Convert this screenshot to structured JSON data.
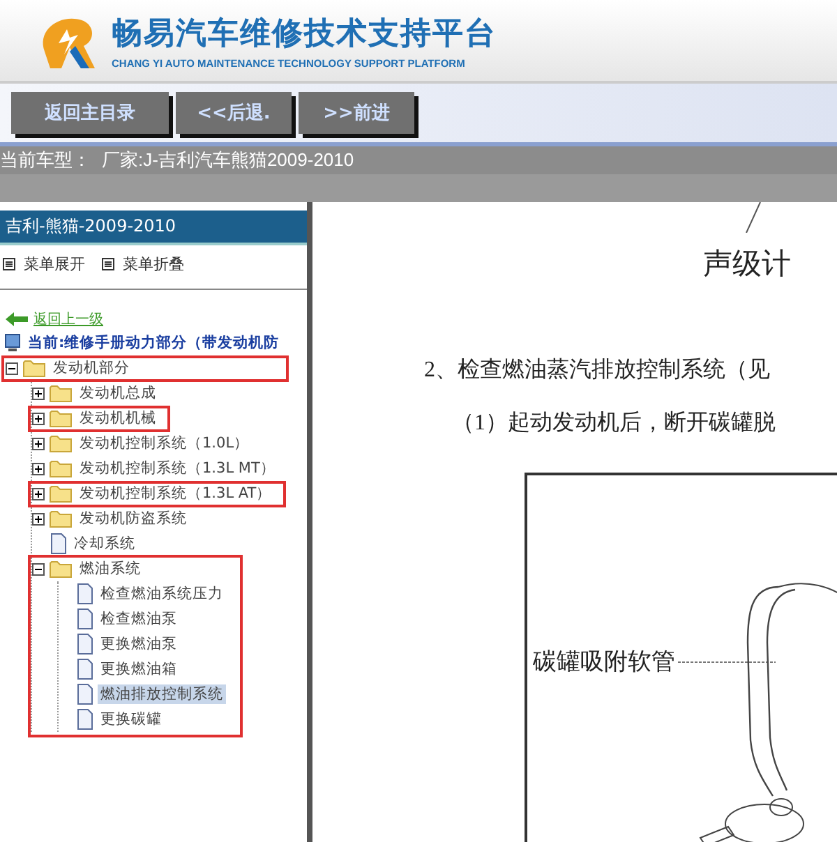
{
  "header": {
    "title": "畅易汽车维修技术支持平台",
    "subtitle": "CHANG YI AUTO MAINTENANCE TECHNOLOGY SUPPORT PLATFORM"
  },
  "toolbar": {
    "buttons": [
      "返回主目录",
      "<<后退.",
      ">>前进"
    ]
  },
  "car_bar": {
    "label": "当前车型：",
    "value": "厂家:J-吉利汽车熊猫2009-2010"
  },
  "sidebar": {
    "title": "吉利-熊猫-2009-2010",
    "menu_actions": [
      "菜单展开",
      "菜单折叠"
    ],
    "back_link": "返回上一级",
    "current": "当前:维修手册动力部分（带发动机防",
    "tree": [
      {
        "label": "发动机部分",
        "kind": "folder",
        "expanded": true,
        "marked": true,
        "selected": false,
        "children": [
          {
            "label": "发动机总成",
            "kind": "folder",
            "expanded": false,
            "marked": false,
            "selected": false
          },
          {
            "label": "发动机机械",
            "kind": "folder",
            "expanded": false,
            "marked": true,
            "selected": false
          },
          {
            "label": "发动机控制系统（1.0L）",
            "kind": "folder",
            "expanded": false,
            "marked": false,
            "selected": false
          },
          {
            "label": "发动机控制系统（1.3L MT）",
            "kind": "folder",
            "expanded": false,
            "marked": false,
            "selected": false
          },
          {
            "label": "发动机控制系统（1.3L AT）",
            "kind": "folder",
            "expanded": false,
            "marked": true,
            "selected": false
          },
          {
            "label": "发动机防盗系统",
            "kind": "folder",
            "expanded": false,
            "marked": false,
            "selected": false
          },
          {
            "label": "冷却系统",
            "kind": "page",
            "marked": false,
            "selected": false
          },
          {
            "label": "燃油系统",
            "kind": "folder",
            "expanded": true,
            "marked": false,
            "group_marked": true,
            "selected": false,
            "children": [
              {
                "label": "检查燃油系统压力",
                "kind": "page",
                "marked": false,
                "selected": false
              },
              {
                "label": "检查燃油泵",
                "kind": "page",
                "marked": false,
                "selected": false
              },
              {
                "label": "更换燃油泵",
                "kind": "page",
                "marked": false,
                "selected": false
              },
              {
                "label": "更换燃油箱",
                "kind": "page",
                "marked": false,
                "selected": false
              },
              {
                "label": "燃油排放控制系统",
                "kind": "page",
                "marked": false,
                "selected": true
              },
              {
                "label": "更换碳罐",
                "kind": "page",
                "marked": false,
                "selected": false
              }
            ]
          }
        ]
      }
    ]
  },
  "document": {
    "caption": "声级计",
    "step": "2、检查燃油蒸汽排放控制系统（见",
    "substep": "（1）起动发动机后，断开碳罐脱",
    "figure_label": "碳罐吸附软管"
  }
}
